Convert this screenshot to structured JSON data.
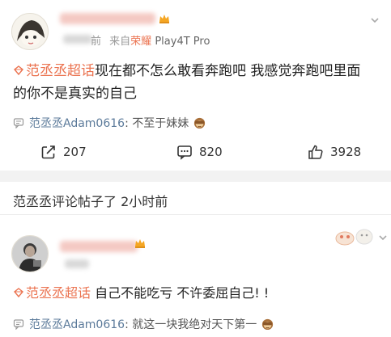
{
  "post": {
    "source_prefix": "来自",
    "source_brand": "荣耀",
    "source_device": "Play4T Pro",
    "time_tail": "前",
    "topic": "范丞丞超话",
    "text_line1": "现在都不怎么敢看奔跑吧 我感觉奔跑吧里面",
    "text_line2": "的你不是真实的自己",
    "comment_user": "范丞丞Adam0616",
    "comment_text": ": 不至于妹妹",
    "comment_emoji": "monkey-see-no-evil-icon",
    "repost_count": "207",
    "comment_count": "820",
    "like_count": "3928"
  },
  "reply_notice": "范丞丞评论帖子了 2小时前",
  "post2": {
    "topic": "范丞丞超话",
    "text": " 自己不能吃亏 不许委屈自己! !",
    "comment_user": "范丞丞Adam0616",
    "comment_text": ": 就这一块我绝对天下第一",
    "comment_emoji": "monkey-see-no-evil-icon"
  },
  "colors": {
    "accent": "#eb7350",
    "link_blue": "#5b7a9a",
    "muted": "#999999",
    "separator": "#f2f2f2"
  }
}
